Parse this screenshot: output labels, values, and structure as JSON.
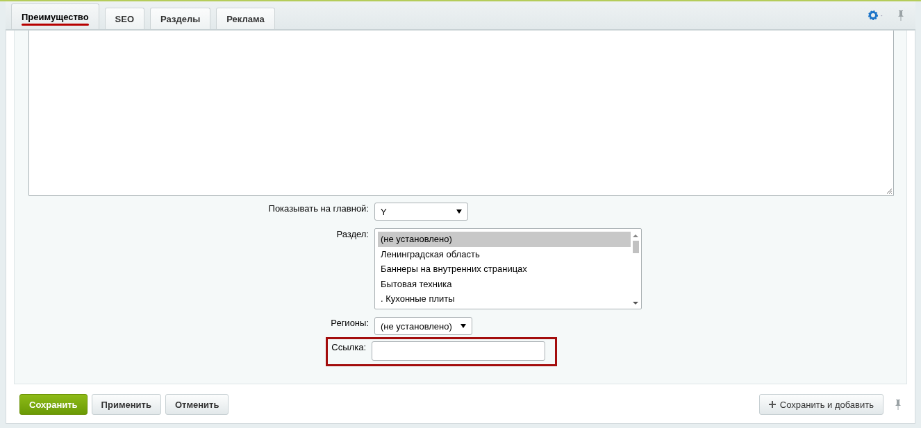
{
  "tabs": [
    {
      "label": "Преимущество",
      "selected": true
    },
    {
      "label": "SEO",
      "selected": false
    },
    {
      "label": "Разделы",
      "selected": false
    },
    {
      "label": "Реклама",
      "selected": false
    }
  ],
  "fields": [
    {
      "kind": "select",
      "label": "Показывать на главной:",
      "value": "Y",
      "highlighted": false
    },
    {
      "kind": "listbox",
      "label": "Раздел:",
      "highlighted": false,
      "options": [
        {
          "label": "(не установлено)",
          "selected": true
        },
        {
          "label": "Ленинградская область",
          "selected": false
        },
        {
          "label": "Баннеры на внутренних страницах",
          "selected": false
        },
        {
          "label": "Бытовая техника",
          "selected": false
        },
        {
          "label": ". Кухонные плиты",
          "selected": false
        }
      ]
    },
    {
      "kind": "select",
      "label": "Регионы:",
      "value": "(не установлено)",
      "highlighted": false
    },
    {
      "kind": "input",
      "label": "Ссылка:",
      "highlighted": true
    }
  ],
  "buttons": [
    {
      "label": "Сохранить",
      "kind": "primary"
    },
    {
      "label": "Применить",
      "kind": "default"
    },
    {
      "label": "Отменить",
      "kind": "default"
    }
  ],
  "save_and_add_button": {
    "label": "Сохранить и добавить"
  }
}
